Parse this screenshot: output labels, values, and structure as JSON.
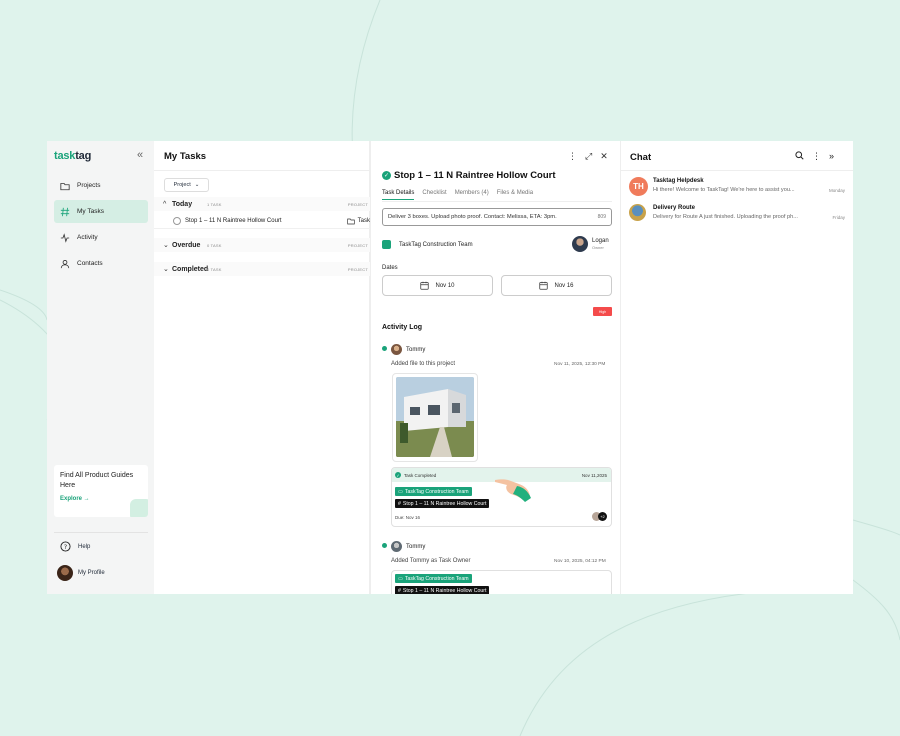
{
  "sidebar": {
    "logo_part1": "task",
    "logo_part2": "tag",
    "collapse": "«",
    "items": [
      {
        "label": "Projects"
      },
      {
        "label": "My Tasks"
      },
      {
        "label": "Activity"
      },
      {
        "label": "Contacts"
      }
    ],
    "guide": {
      "title": "Find All Product Guides Here",
      "link": "Explore →"
    },
    "help": "Help",
    "profile": "My Profile"
  },
  "tasks": {
    "title": "My Tasks",
    "project_filter": "Project",
    "groups": [
      {
        "name": "Today",
        "count": "1 TASK",
        "project_col": "PROJECT"
      },
      {
        "name": "Overdue",
        "count": "0 TASK",
        "project_col": "PROJECT"
      },
      {
        "name": "Completed",
        "count": "0 TASK",
        "project_col": "PROJECT"
      }
    ],
    "task_row": {
      "name": "Stop 1 – 11 N Raintree Hollow Court",
      "project": "Task"
    }
  },
  "detail": {
    "title": "Stop 1 – 11 N Raintree Hollow Court",
    "tabs": [
      "Task Details",
      "Checklist",
      "Members (4)",
      "Files & Media"
    ],
    "description": "Deliver 3 boxes. Upload photo proof. Contact: Melissa, ETA: 3pm.",
    "description_count": "809",
    "team": "TaskTag Construction Team",
    "owner_name": "Logan",
    "owner_role": "Owner",
    "dates_label": "Dates",
    "start_date": "Nov 10",
    "end_date": "Nov 16",
    "priority": "High",
    "activity_title": "Activity Log",
    "activities": [
      {
        "user": "Tommy",
        "text": "Added file to this project",
        "time": "Nov 11, 2025, 12:30 PM"
      },
      {
        "user": "Tommy",
        "text": "Added Tommy as Task Owner",
        "time": "Nov 10, 2025, 04:12 PM"
      }
    ],
    "completed_card": {
      "label": "Task Completed",
      "date": "Nov 11,2025",
      "team_tag": "TaskTag Construction Team",
      "task_tag": "Stop 1 – 11 N Raintree Hollow Court",
      "due": "Due: Nov 16",
      "more": "+2"
    },
    "card2": {
      "team_tag": "TaskTag Construction Team",
      "task_tag": "Stop 1 – 11 N Raintree Hollow Court"
    }
  },
  "chat": {
    "title": "Chat",
    "items": [
      {
        "name": "Tasktag Helpdesk",
        "initials": "TH",
        "message": "Hi there! Welcome to TaskTag! We're here to assist you...",
        "day": "Monday"
      },
      {
        "name": "Delivery Route",
        "message": "Delivery for Route A just finished. Uploading the proof ph...",
        "day": "Friday"
      }
    ]
  },
  "colors": {
    "accent": "#1aa37a",
    "priority": "#f44b4b",
    "background": "#dff3ec"
  }
}
